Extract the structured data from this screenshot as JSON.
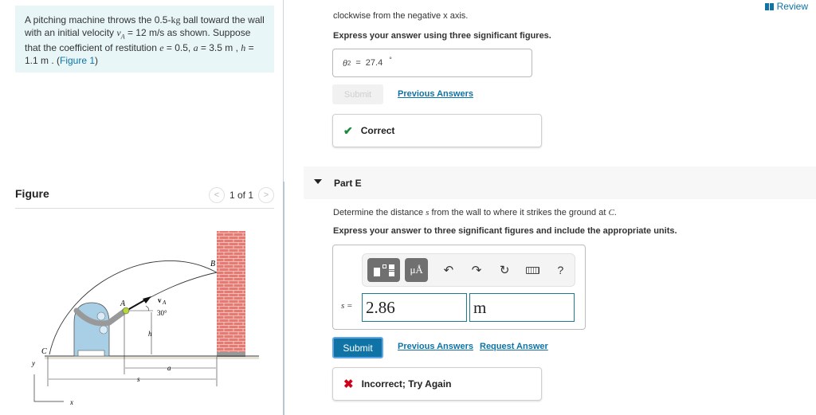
{
  "problem": {
    "text_1": "A pitching machine throws the 0.5-",
    "kg": "kg",
    "text_2": " ball toward the wall with an initial velocity ",
    "vA": "v",
    "vA_sub": "A",
    "text_3": " = 12  m/s as shown. Suppose that the coefficient of restitution ",
    "e": "e",
    "text_4": " = 0.5, ",
    "a": "a",
    "text_5": " = 3.5  m , ",
    "h": "h",
    "text_6": " = 1.1  m . (",
    "figure_link": "Figure 1",
    "text_7": ")"
  },
  "figure_panel": {
    "title": "Figure",
    "pager": "1 of 1",
    "prev": "<",
    "next": ">",
    "labels": {
      "A": "A",
      "B": "B",
      "C": "C",
      "vA": "v",
      "vA_sub": "A",
      "angle": "30°",
      "h": "h",
      "a": "a",
      "s": "s",
      "x": "x",
      "y": "y"
    }
  },
  "review": {
    "label": "Review"
  },
  "part_d": {
    "cutoff_text": "clockwise from the negative x axis.",
    "instruction": "Express your answer using three significant figures.",
    "answer_var": "θ",
    "answer_sub": "2",
    "answer_value": "27.4",
    "answer_unit": "°",
    "submit_label": "Submit",
    "previous_answers": "Previous Answers",
    "feedback": "Correct",
    "feedback_color": "#1a8a3a"
  },
  "part_e": {
    "label": "Part E",
    "question_1": "Determine the distance ",
    "question_var": "s",
    "question_2": " from the wall to where it strikes the ground at ",
    "question_point": "C",
    "question_3": ".",
    "instruction": "Express your answer to three significant figures and include the appropriate units.",
    "toolbar": {
      "templates": "templates-icon",
      "units": "μÅ",
      "undo": "↶",
      "redo": "↷",
      "reset": "↻",
      "keyboard": "keyboard-icon",
      "help": "?"
    },
    "var_label": "s =",
    "value": "2.86",
    "unit": "m",
    "submit_label": "Submit",
    "previous_answers": "Previous Answers",
    "request_answer": "Request Answer",
    "feedback": "Incorrect; Try Again",
    "feedback_color": "#d0021b",
    "accent": "#0f73a6"
  }
}
